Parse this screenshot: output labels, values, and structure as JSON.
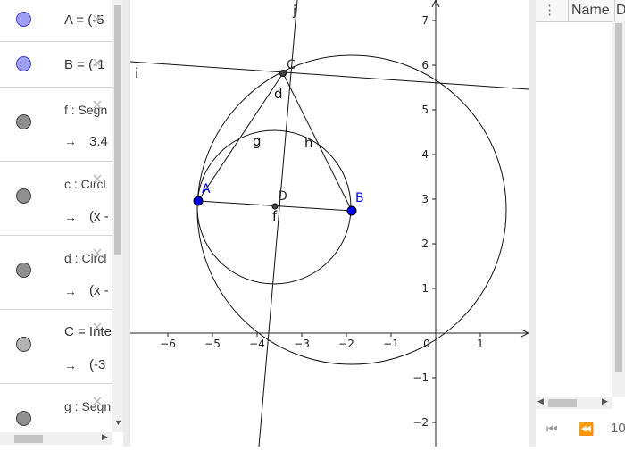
{
  "algebra": {
    "rows": [
      {
        "def": "A = (-5",
        "value": "",
        "dot": "blue"
      },
      {
        "def": "B = (-1",
        "value": "",
        "dot": "blue"
      },
      {
        "def": "f : Segn",
        "value": "3.4",
        "dot": "gray"
      },
      {
        "def": "c : Circl",
        "value": "(x -",
        "dot": "gray"
      },
      {
        "def": "d : Circl",
        "value": "(x -",
        "dot": "gray"
      },
      {
        "def": "C = Inte",
        "value": "(-3",
        "dot": "lgray"
      },
      {
        "def": "g : Segn",
        "value": "",
        "dot": "gray"
      }
    ],
    "arrow": "→",
    "delete": "×"
  },
  "graph": {
    "x_ticks": [
      "−6",
      "−5",
      "−4",
      "−3",
      "−2",
      "−1",
      "0",
      "1"
    ],
    "y_ticks": [
      "7",
      "6",
      "5",
      "4",
      "3",
      "2",
      "1",
      "−1",
      "−2"
    ],
    "point_labels": {
      "A": "A",
      "B": "B",
      "C": "C",
      "D": "D"
    },
    "object_labels": {
      "i": "i",
      "j": "j",
      "d": "d",
      "f": "f",
      "g": "g",
      "h": "h"
    },
    "colors": {
      "point": "#0000e6",
      "line": "#000000",
      "label_blue": "#0000ff"
    }
  },
  "spreadsheet": {
    "menu_icon": "⋮",
    "col_name": "Name",
    "col_next": "D",
    "nav_first": "⏮",
    "nav_prev": "⏪",
    "nav_value": "10"
  }
}
